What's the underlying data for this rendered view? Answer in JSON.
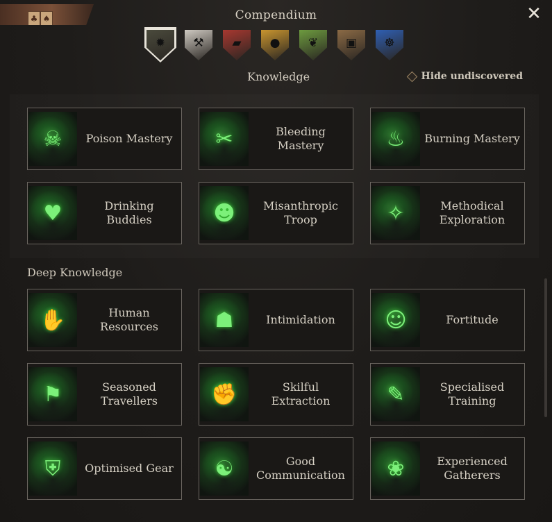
{
  "header": {
    "title": "Compendium",
    "close_glyph": "✕"
  },
  "tabs": [
    {
      "name": "skills-tab",
      "icon": "sun-gear-icon",
      "color": "#4a4a3c",
      "glyph": "✹",
      "active": true
    },
    {
      "name": "crafting-tab",
      "icon": "hammer-wrench-icon",
      "color": "#cfcac2",
      "glyph": "⚒"
    },
    {
      "name": "smithing-tab",
      "icon": "anvil-icon",
      "color": "#a83830",
      "glyph": "▰"
    },
    {
      "name": "cooking-tab",
      "icon": "cauldron-icon",
      "color": "#c9952f",
      "glyph": "●"
    },
    {
      "name": "herbs-tab",
      "icon": "herb-pouch-icon",
      "color": "#6d9b3f",
      "glyph": "❦"
    },
    {
      "name": "gear-tab",
      "icon": "backpack-icon",
      "color": "#8b6a45",
      "glyph": "▣"
    },
    {
      "name": "navigation-tab",
      "icon": "ship-wheel-icon",
      "color": "#2f5fb3",
      "glyph": "☸"
    }
  ],
  "section1": {
    "title": "Knowledge"
  },
  "hide_undiscovered": {
    "label": "Hide undiscovered"
  },
  "section2": {
    "title": "Deep Knowledge"
  },
  "knowledge_cards": [
    {
      "label": "Poison Mastery",
      "icon": "poison-mastery-icon",
      "glyph": "☠"
    },
    {
      "label": "Bleeding Mastery",
      "icon": "bleeding-mastery-icon",
      "glyph": "✂"
    },
    {
      "label": "Burning Mastery",
      "icon": "burning-mastery-icon",
      "glyph": "♨"
    },
    {
      "label": "Drinking Buddies",
      "icon": "drinking-buddies-icon",
      "glyph": "♥"
    },
    {
      "label": "Misanthropic Troop",
      "icon": "misanthropic-troop-icon",
      "glyph": "☻"
    },
    {
      "label": "Methodical Exploration",
      "icon": "compass-icon",
      "glyph": "✧"
    }
  ],
  "deep_cards": [
    {
      "label": "Human Resources",
      "icon": "human-resources-icon",
      "glyph": "✋"
    },
    {
      "label": "Intimidation",
      "icon": "intimidation-icon",
      "glyph": "☗"
    },
    {
      "label": "Fortitude",
      "icon": "fortitude-icon",
      "glyph": "☺"
    },
    {
      "label": "Seasoned Travellers",
      "icon": "seasoned-travellers-icon",
      "glyph": "⚑"
    },
    {
      "label": "Skilful Extraction",
      "icon": "skilful-extraction-icon",
      "glyph": "✊"
    },
    {
      "label": "Specialised Training",
      "icon": "specialised-training-icon",
      "glyph": "✎"
    },
    {
      "label": "Optimised Gear",
      "icon": "optimised-gear-icon",
      "glyph": "⛨"
    },
    {
      "label": "Good Communication",
      "icon": "good-communication-icon",
      "glyph": "☯"
    },
    {
      "label": "Experienced Gatherers",
      "icon": "experienced-gatherers-icon",
      "glyph": "❀"
    }
  ]
}
